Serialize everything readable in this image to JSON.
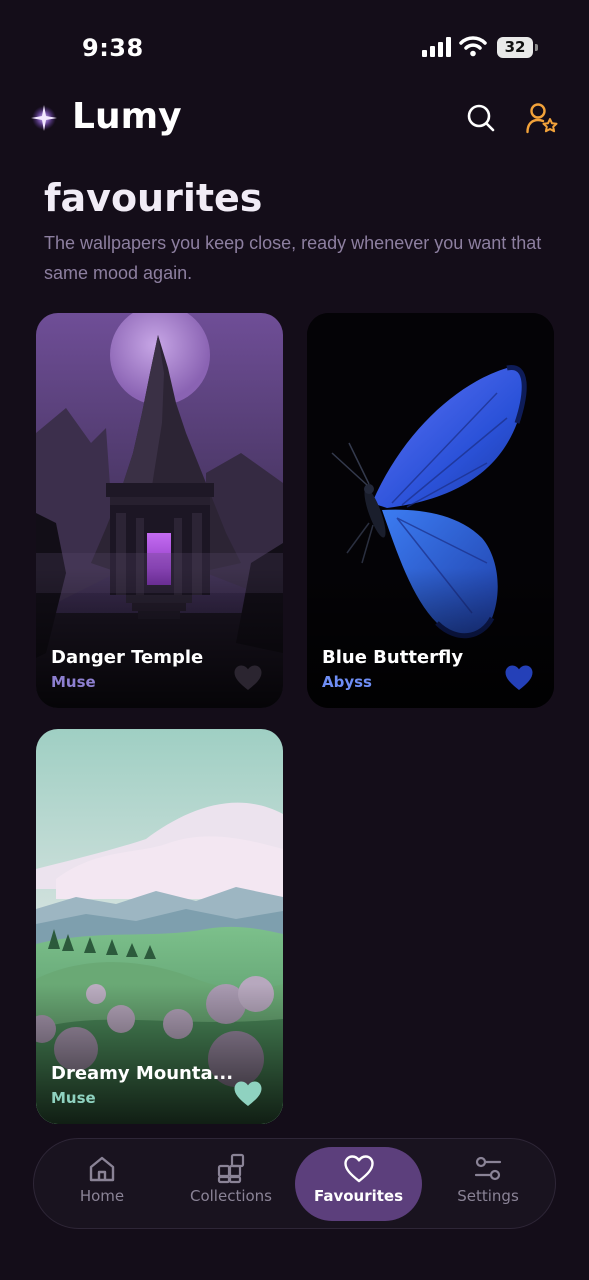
{
  "status_bar": {
    "time": "9:38",
    "battery": "32"
  },
  "app": {
    "name": "Lumy"
  },
  "page": {
    "title": "favourites",
    "subtitle": "The wallpapers you keep close, ready whenever you want that same mood again."
  },
  "favourites": [
    {
      "name": "Danger Temple",
      "category": "Muse",
      "category_color": "#8d7fd0",
      "heart_color": "#2b2530"
    },
    {
      "name": "Blue Butterfly",
      "category": "Abyss",
      "category_color": "#6f8ef5",
      "heart_color": "#2440b8"
    },
    {
      "name": "Dreamy Mounta...",
      "category": "Muse",
      "category_color": "#8fd2c0",
      "heart_color": "#8fd2c0"
    }
  ],
  "nav": {
    "items": [
      {
        "label": "Home",
        "icon": "home-icon"
      },
      {
        "label": "Collections",
        "icon": "collections-icon"
      },
      {
        "label": "Favourites",
        "icon": "heart-icon"
      },
      {
        "label": "Settings",
        "icon": "sliders-icon"
      }
    ],
    "active": "Favourites"
  },
  "colors": {
    "background": "#140d19",
    "accent": "#5c3f7c",
    "profile_icon": "#f2a23a"
  }
}
